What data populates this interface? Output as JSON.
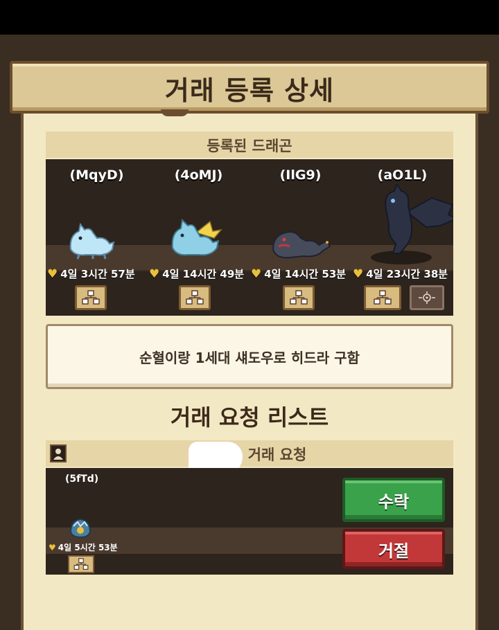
{
  "header": {
    "title": "거래 등록 상세"
  },
  "registered": {
    "section_label": "등록된 드래곤",
    "dragons": [
      {
        "name": "(MqyD)",
        "timer": "4일 3시간 57분",
        "color": "#bfe6f6"
      },
      {
        "name": "(4oMJ)",
        "timer": "4일 14시간 49분",
        "color": "#8fd0e6"
      },
      {
        "name": "(IlG9)",
        "timer": "4일 14시간 53분",
        "color": "#474c5c"
      },
      {
        "name": "(aO1L)",
        "timer": "4일 23시간 38분",
        "color": "#2c3244"
      }
    ]
  },
  "memo": {
    "text": "순혈이랑 1세대 섀도우로 히드라 구함"
  },
  "requests": {
    "title": "거래 요청 리스트",
    "strip_label": "거래 요청",
    "item": {
      "name": "(5fTd)",
      "timer": "4일 5시간 53분"
    },
    "accept_label": "수락",
    "reject_label": "거절"
  },
  "colors": {
    "accept": "#3aa24a",
    "reject": "#c23838",
    "panel": "#f3e8c4",
    "heart": "#e9c03c"
  }
}
